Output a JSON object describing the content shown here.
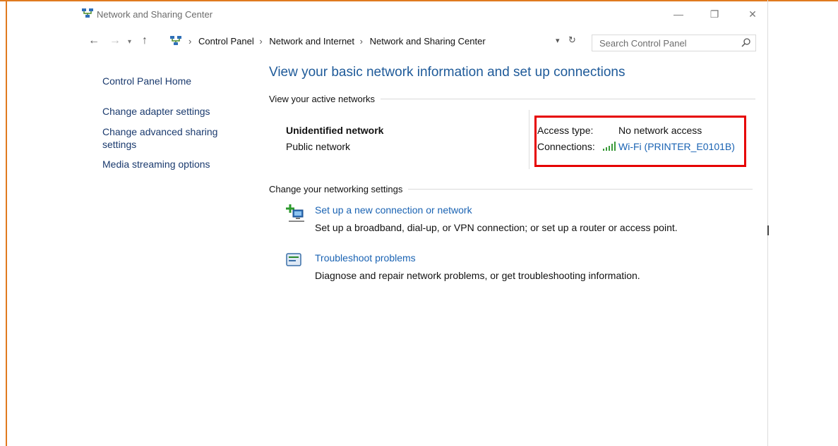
{
  "window": {
    "title": "Network and Sharing Center",
    "controls": {
      "minimize": "—",
      "maximize": "❐",
      "close": "✕"
    }
  },
  "address_bar": {
    "breadcrumbs": [
      "Control Panel",
      "Network and Internet",
      "Network and Sharing Center"
    ],
    "separator": "›"
  },
  "search": {
    "placeholder": "Search Control Panel"
  },
  "sidebar": {
    "items": [
      {
        "label": "Control Panel Home"
      },
      {
        "label": "Change adapter settings"
      },
      {
        "label": "Change advanced sharing settings"
      },
      {
        "label": "Media streaming options"
      }
    ]
  },
  "main": {
    "title": "View your basic network information and set up connections",
    "active_networks_heading": "View your active networks",
    "network": {
      "name": "Unidentified network",
      "type": "Public network",
      "access_type_label": "Access type:",
      "access_type_value": "No network access",
      "connections_label": "Connections:",
      "connection_name": "Wi-Fi (PRINTER_E0101B)"
    },
    "change_settings_heading": "Change your networking settings",
    "tasks": [
      {
        "icon": "new-connection-icon",
        "link": "Set up a new connection or network",
        "description": "Set up a broadband, dial-up, or VPN connection; or set up a router or access point."
      },
      {
        "icon": "troubleshoot-icon",
        "link": "Troubleshoot problems",
        "description": "Diagnose and repair network problems, or get troubleshooting information."
      }
    ]
  },
  "colors": {
    "frame_accent": "#e07a1f",
    "title_blue": "#1e5a99",
    "link_blue": "#1a63b3",
    "highlight_red": "#e60000"
  }
}
